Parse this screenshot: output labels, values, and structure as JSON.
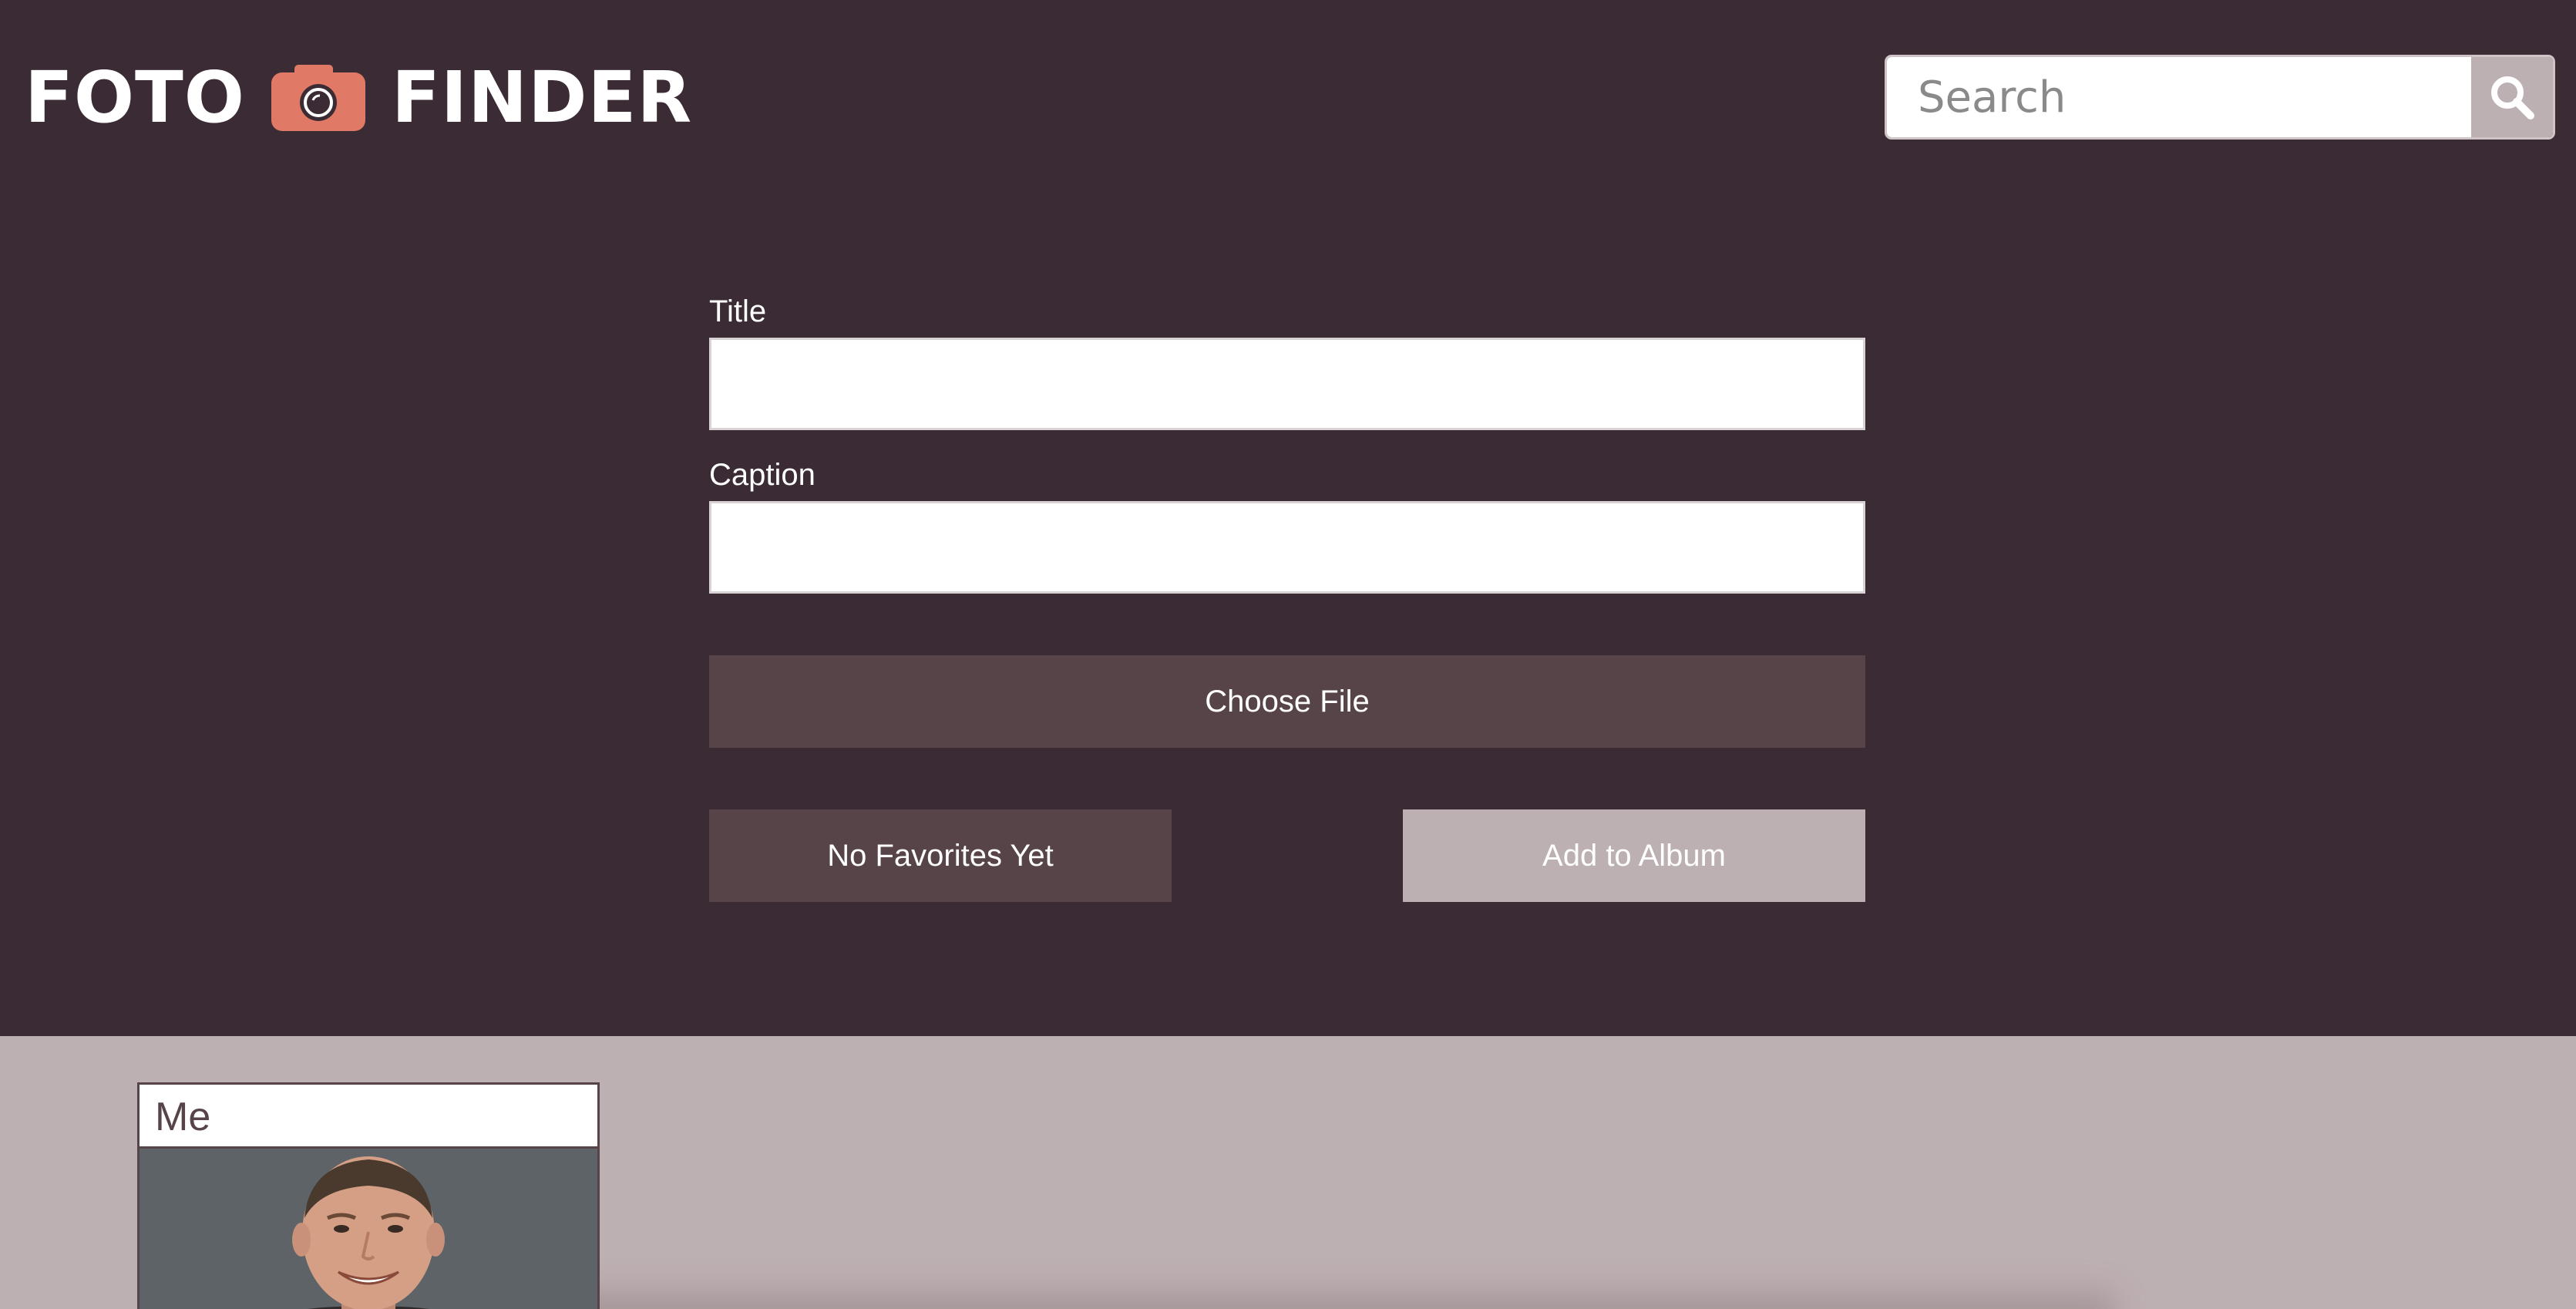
{
  "app": {
    "logo_left": "FOTO",
    "logo_right": "FINDER",
    "camera_icon": "camera-icon",
    "accent": "#e07a66"
  },
  "search": {
    "placeholder": "Search",
    "icon": "search-icon"
  },
  "form": {
    "title_label": "Title",
    "title_value": "",
    "caption_label": "Caption",
    "caption_value": "",
    "choose_file_label": "Choose File",
    "favorites_label": "No Favorites Yet",
    "add_album_label": "Add to Album"
  },
  "gallery": {
    "cards": [
      {
        "title": "Me"
      }
    ]
  },
  "colors": {
    "background": "#3b2b35",
    "button_dark": "#574448",
    "button_light": "#bdb0b2",
    "gallery_bg": "#bdb0b2"
  }
}
